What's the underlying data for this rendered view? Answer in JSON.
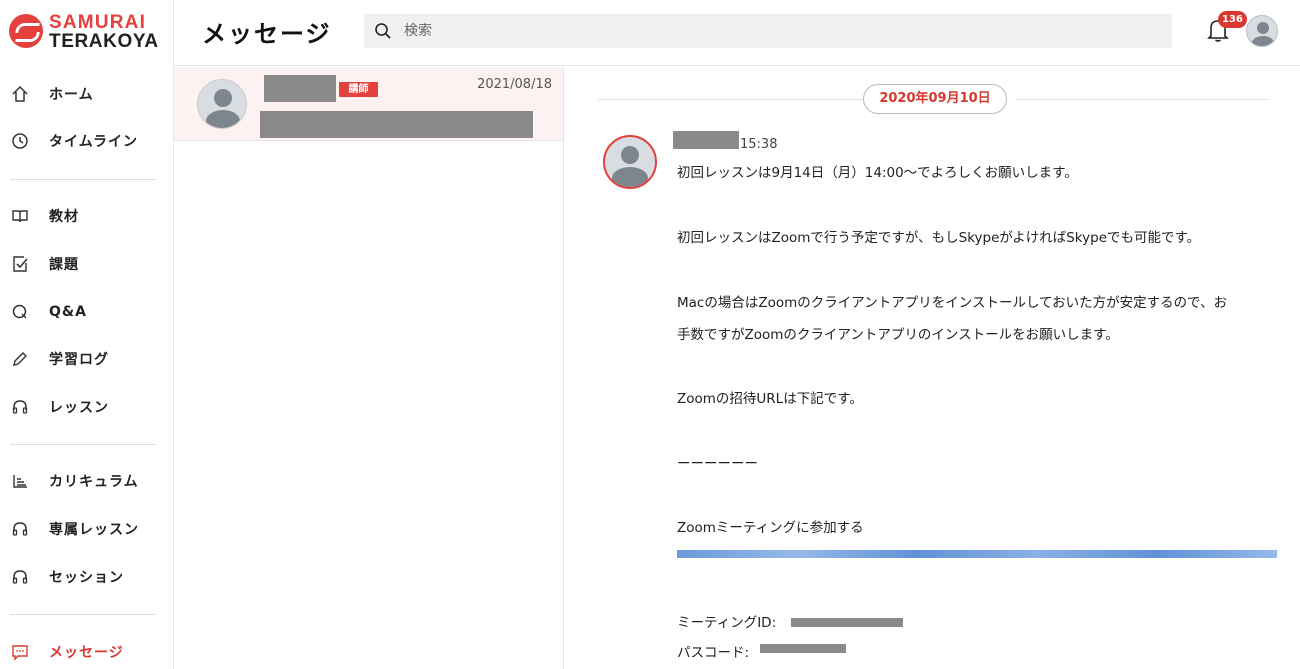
{
  "brand": {
    "line1": "SAMURAI",
    "line2": "TERAKOYA",
    "accent": "#e4403c"
  },
  "sidebar": {
    "groups": [
      [
        {
          "label": "ホーム",
          "icon": "home-icon"
        },
        {
          "label": "タイムライン",
          "icon": "clock-icon"
        }
      ],
      [
        {
          "label": "教材",
          "icon": "book-icon"
        },
        {
          "label": "課題",
          "icon": "task-icon"
        },
        {
          "label": "Q&A",
          "icon": "qa-icon"
        },
        {
          "label": "学習ログ",
          "icon": "pencil-icon"
        },
        {
          "label": "レッスン",
          "icon": "headset-icon"
        }
      ],
      [
        {
          "label": "カリキュラム",
          "icon": "curriculum-icon"
        },
        {
          "label": "専属レッスン",
          "icon": "headset-icon"
        },
        {
          "label": "セッション",
          "icon": "headset-icon"
        }
      ],
      [
        {
          "label": "メッセージ",
          "icon": "message-icon",
          "active": true
        }
      ]
    ]
  },
  "header": {
    "title": "メッセージ",
    "search_placeholder": "検索",
    "notification_count": "136"
  },
  "conversations": [
    {
      "tag": "講師",
      "date": "2021/08/18"
    }
  ],
  "thread": {
    "date": "2020年09月10日",
    "message": {
      "time": "15:38",
      "lines": [
        "初回レッスンは9月14日（月）14:00〜でよろしくお願いします。",
        "初回レッスンはZoomで行う予定ですが、もしSkypeがよければSkypeでも可能です。",
        "Macの場合はZoomのクライアントアプリをインストールしておいた方が安定するので、お",
        "手数ですがZoomのクライアントアプリのインストールをお願いします。",
        "Zoomの招待URLは下記です。",
        "ーーーーーー",
        "Zoomミーティングに参加する",
        "ミーティングID: ",
        "パスコード: "
      ]
    }
  }
}
